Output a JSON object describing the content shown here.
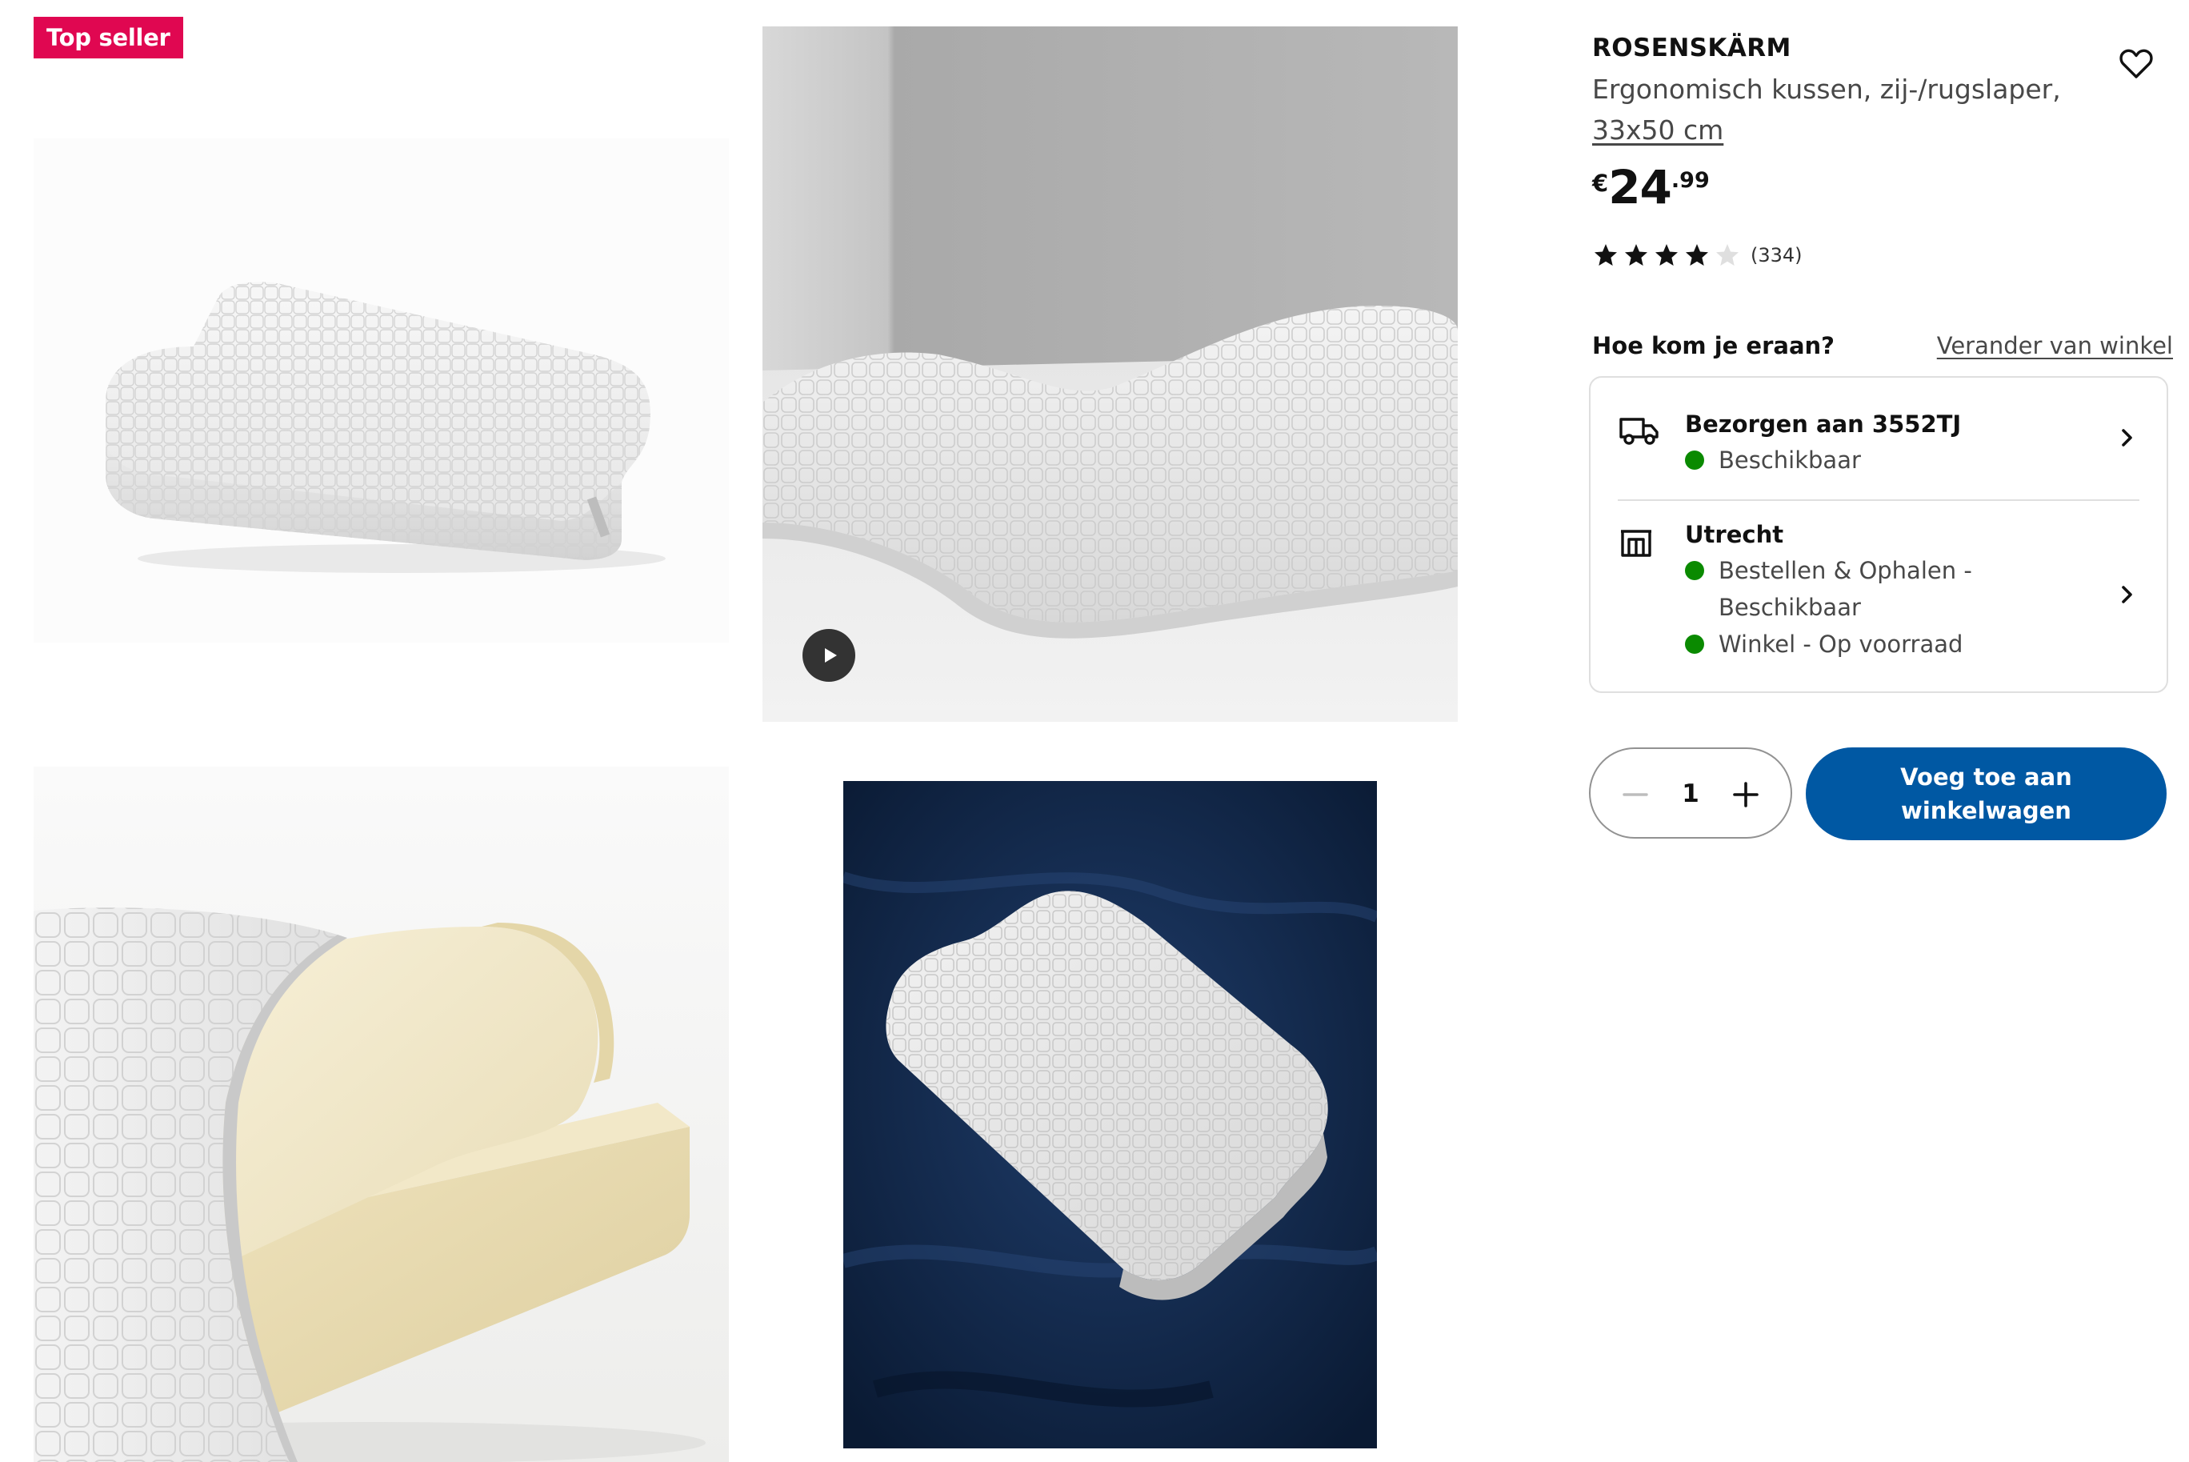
{
  "badge": {
    "label": "Top seller",
    "color": "#e00751"
  },
  "gallery": {
    "images": [
      {
        "name": "pillow-product-photo",
        "background": "#ffffff"
      },
      {
        "name": "pillow-on-bed-video",
        "background": "#b3b3b3",
        "has_video": true
      },
      {
        "name": "pillow-foam-layers",
        "background": "#f6f6f4"
      },
      {
        "name": "pillow-on-navy-sheets",
        "background": "#0f2443"
      }
    ],
    "play_icon": "play-icon"
  },
  "product": {
    "name": "ROSENSKÄRM",
    "description": "Ergonomisch kussen, zij-/rugslaper,",
    "size": "33x50 cm",
    "price": {
      "currency": "€",
      "integer": "24",
      "decimal": ".99"
    },
    "rating": {
      "stars": 4,
      "max": 5,
      "count_label": "(334)"
    },
    "favorite_icon": "heart-outline-icon"
  },
  "availability": {
    "heading": "Hoe kom je eraan?",
    "change_store_label": "Verander van winkel",
    "delivery": {
      "icon": "truck-icon",
      "title": "Bezorgen aan 3552TJ",
      "status": "Beschikbaar"
    },
    "store": {
      "icon": "store-icon",
      "title": "Utrecht",
      "status_1_line_1": "Bestellen & Ophalen -",
      "status_1_line_2": "Beschikbaar",
      "status_2": "Winkel - Op voorraad"
    },
    "status_color": "#0a8a00"
  },
  "cart": {
    "quantity": "1",
    "add_label": "Voeg toe aan winkelwagen",
    "button_color": "#0058a3"
  }
}
